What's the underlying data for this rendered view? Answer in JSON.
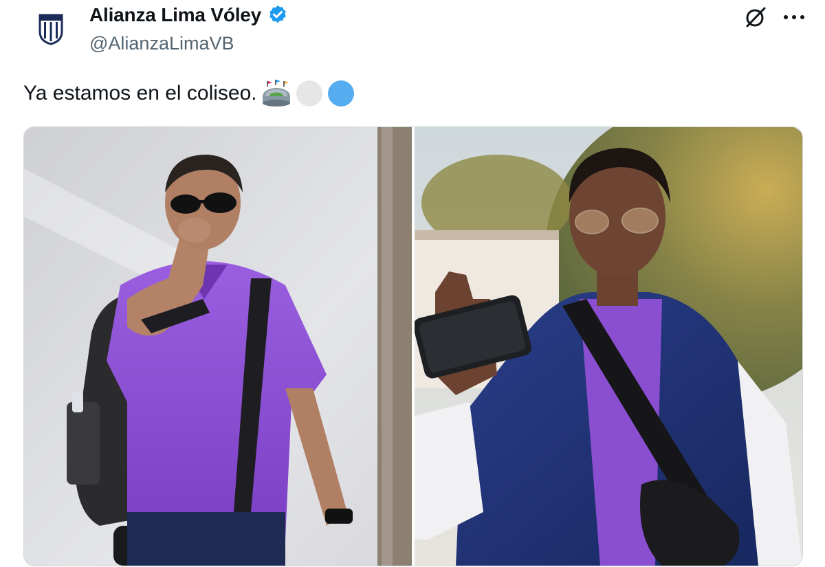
{
  "account": {
    "display_name": "Alianza Lima Vóley",
    "handle": "@AlianzaLimaVB",
    "verified": true,
    "avatar_icon": "club-crest-icon"
  },
  "actions": {
    "grok_icon": "grok-icon",
    "more_icon": "more-options-icon",
    "more_label": "···"
  },
  "tweet": {
    "text": "Ya estamos en el coliseo.",
    "emojis": [
      "stadium-emoji",
      "white-circle-emoji",
      "blue-circle-emoji"
    ]
  },
  "media": {
    "photos": [
      "photo-left",
      "photo-right"
    ]
  },
  "colors": {
    "verified_blue": "#1d9bf0",
    "handle_gray": "#536471",
    "jersey_purple": "#8a4fd0",
    "circle_white": "#e6e6e6",
    "circle_blue": "#55acee"
  }
}
